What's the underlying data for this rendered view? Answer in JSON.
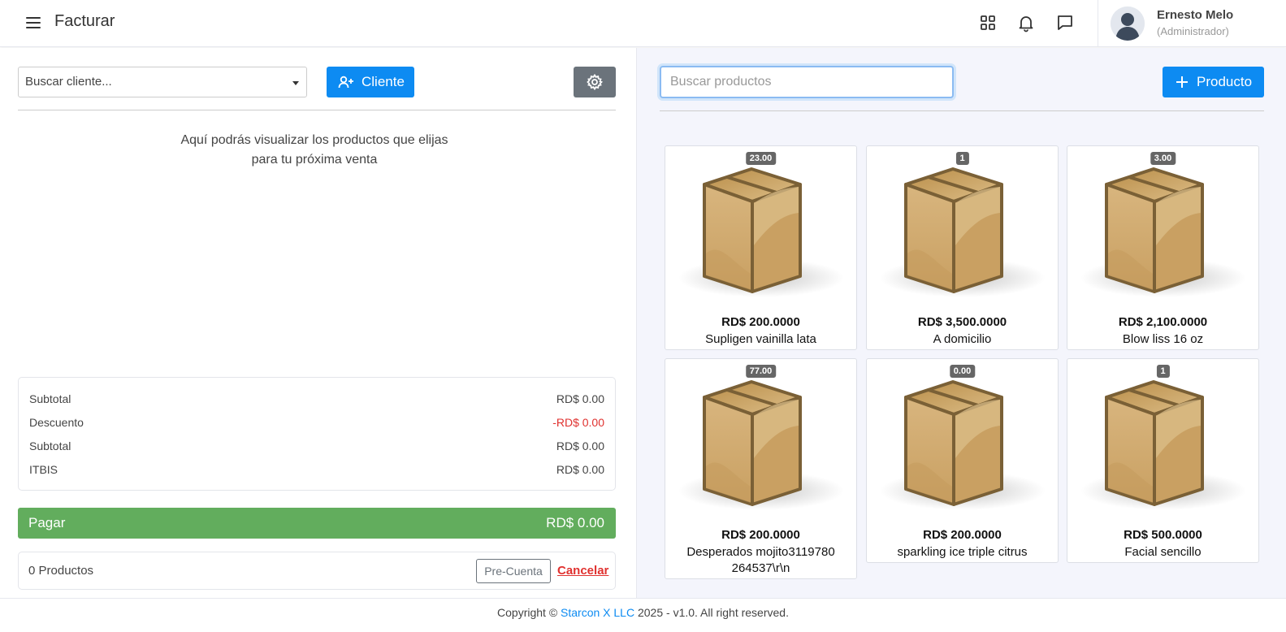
{
  "header": {
    "title": "Facturar",
    "menu_icon": "hamburger-menu-icon",
    "icons": [
      "apps-grid-icon",
      "bell-icon",
      "chat-icon"
    ],
    "user": {
      "name": "Ernesto Melo",
      "role": "(Administrador)"
    }
  },
  "sale": {
    "client_select_placeholder": "Buscar cliente...",
    "add_client_label": "Cliente",
    "empty_line1": "Aquí podrás visualizar los productos que elijas",
    "empty_line2": "para tu próxima venta",
    "totals": [
      {
        "label": "Subtotal",
        "value": "RD$ 0.00"
      },
      {
        "label": "Descuento",
        "value": "-RD$ 0.00"
      },
      {
        "label": "Subtotal",
        "value": "RD$ 0.00"
      },
      {
        "label": "ITBIS",
        "value": "RD$ 0.00"
      }
    ],
    "pay_label": "Pagar",
    "pay_amount": "RD$ 0.00",
    "products_count": "0 Productos",
    "precuenta_label": "Pre-Cuenta",
    "cancel_label": "Cancelar"
  },
  "catalog": {
    "search_placeholder": "Buscar productos",
    "add_product_label": "Producto",
    "products": [
      {
        "stock": "23.00",
        "price": "RD$ 200.0000",
        "name": "Supligen vainilla lata"
      },
      {
        "stock": "1",
        "price": "RD$ 3,500.0000",
        "name": "A domicilio"
      },
      {
        "stock": "3.00",
        "price": "RD$ 2,100.0000",
        "name": "Blow liss 16 oz"
      },
      {
        "stock": "77.00",
        "price": "RD$ 200.0000",
        "name": "Desperados mojito3119780264537\\r\\n"
      },
      {
        "stock": "0.00",
        "price": "RD$ 200.0000",
        "name": "sparkling ice triple citrus"
      },
      {
        "stock": "1",
        "price": "RD$ 500.0000",
        "name": "Facial sencillo"
      }
    ]
  },
  "footer": {
    "prefix": "Copyright © ",
    "company": "Starcon X LLC",
    "suffix": " 2025 - v1.0. All right reserved."
  },
  "colors": {
    "primary": "#0d8bf2",
    "success": "#62ad5d",
    "danger": "#e0312f",
    "secondary": "#6b737b"
  }
}
